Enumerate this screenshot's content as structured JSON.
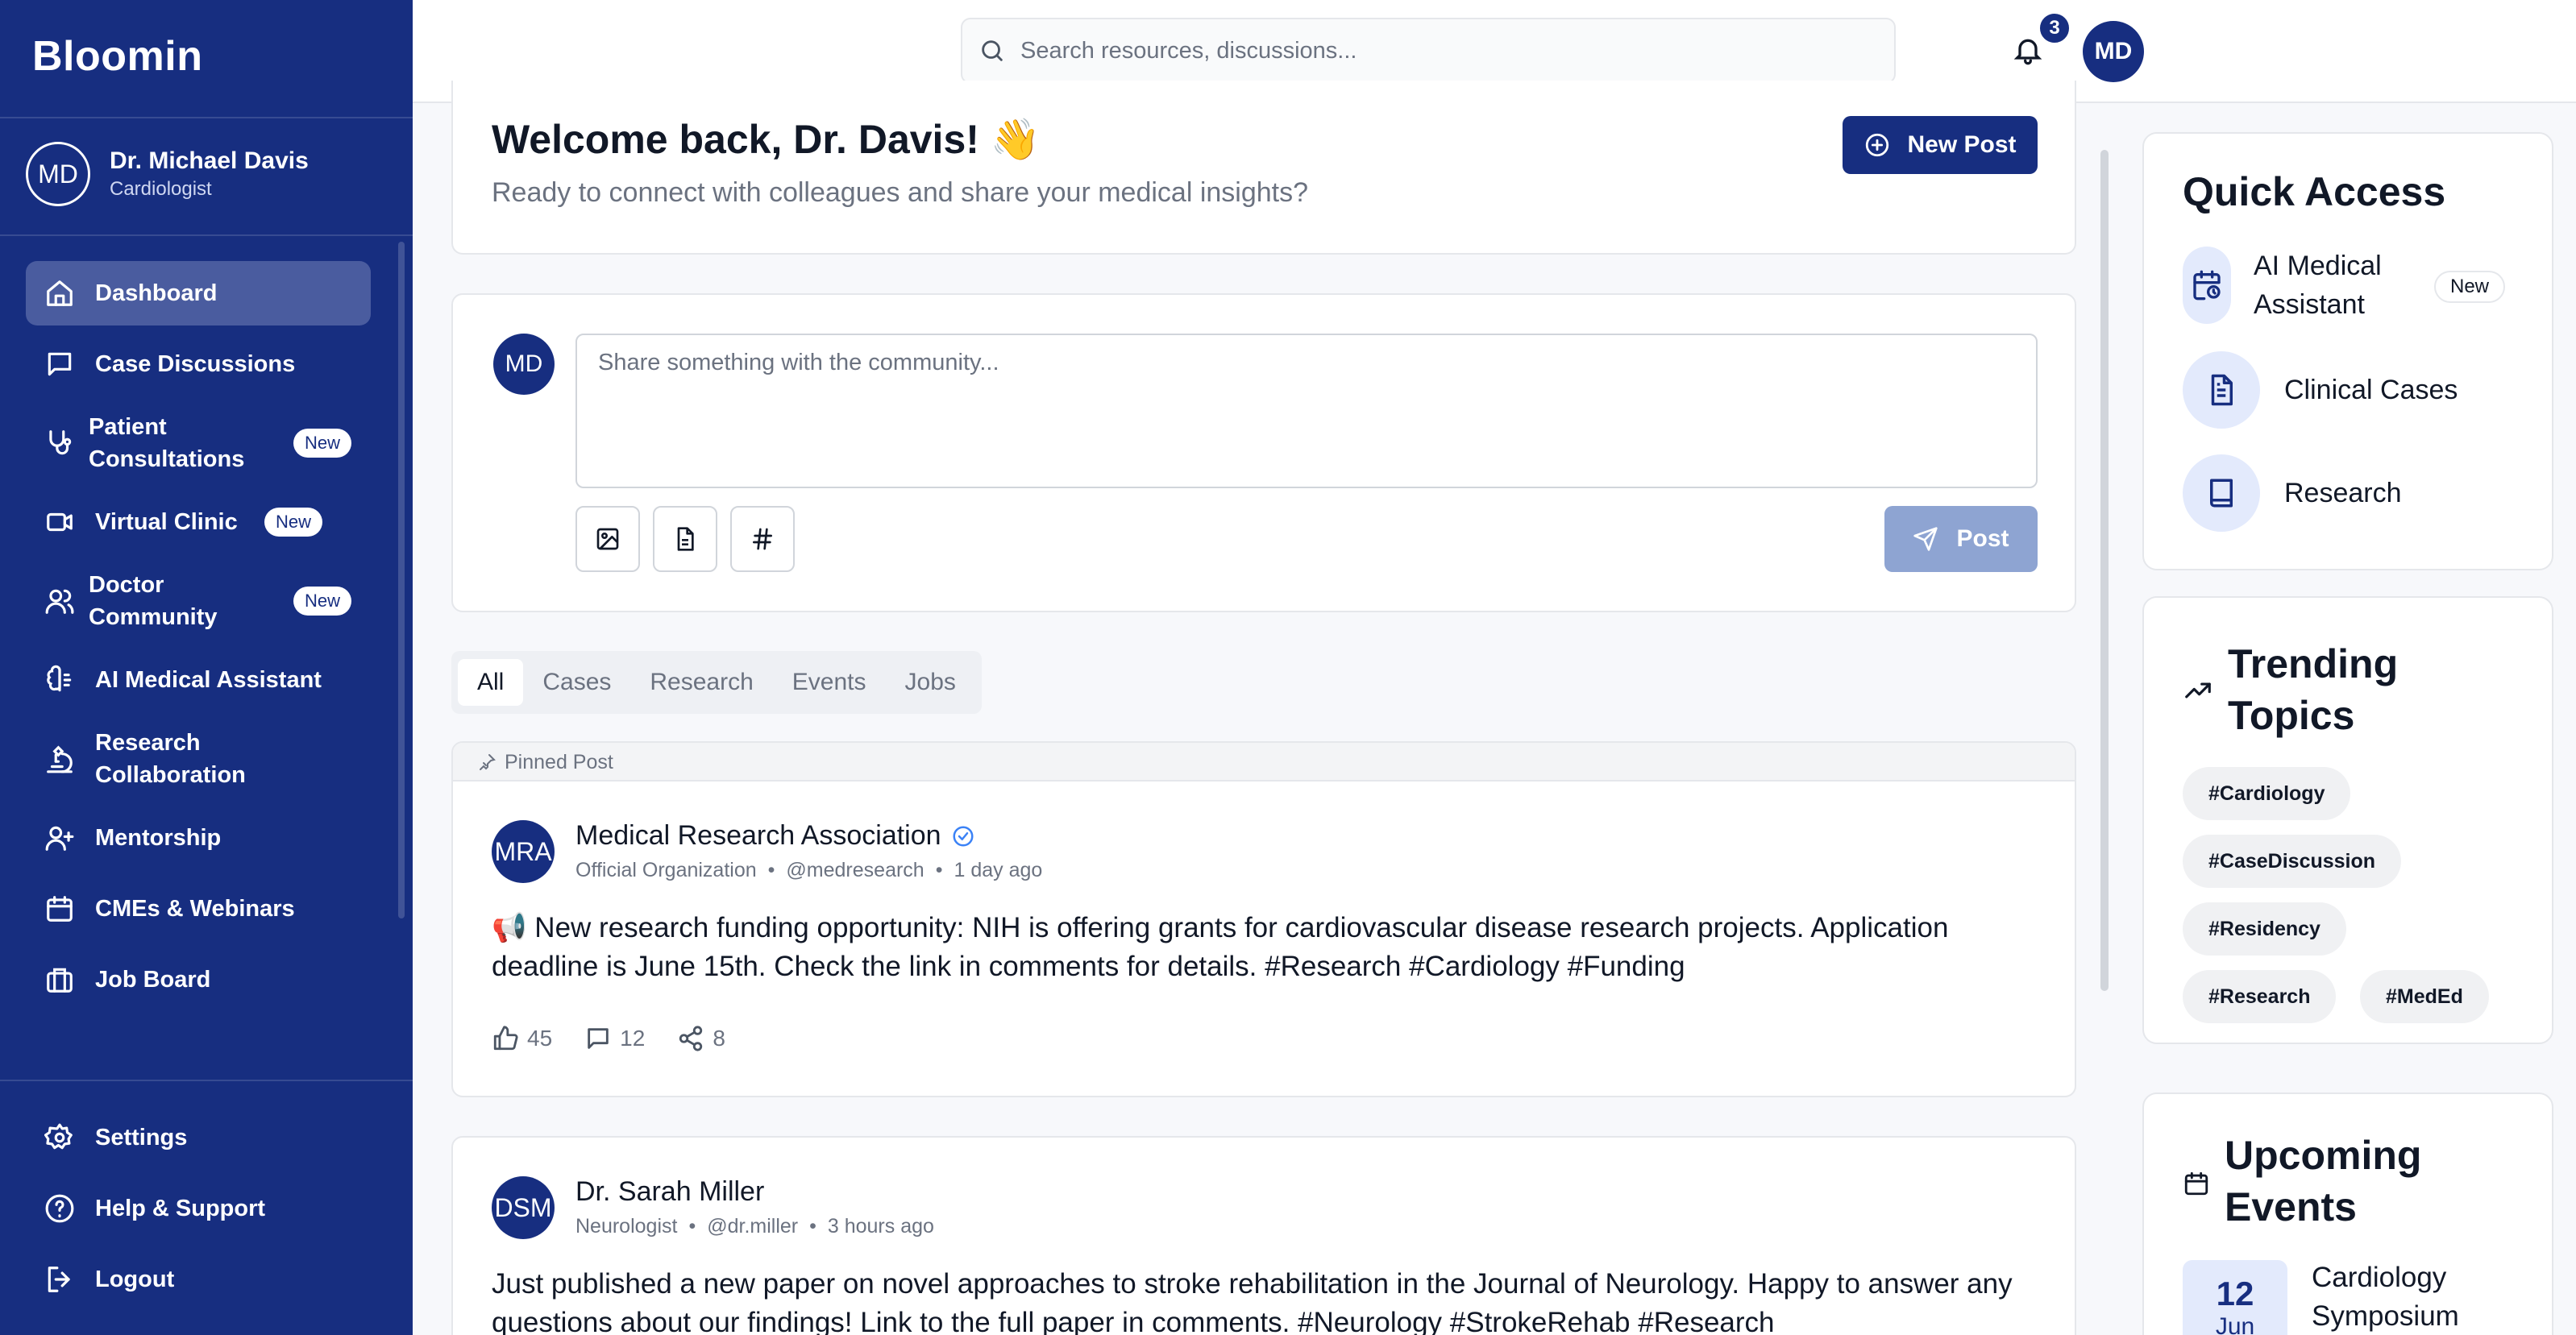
{
  "app": {
    "name": "Bloomin"
  },
  "user": {
    "name": "Dr. Michael Davis",
    "role": "Cardiologist",
    "initials": "MD"
  },
  "sidebar": {
    "items": [
      {
        "label": "Dashboard",
        "icon": "home-icon",
        "active": true
      },
      {
        "label": "Case Discussions",
        "icon": "message-square-icon"
      },
      {
        "label": "Patient Consultations",
        "icon": "stethoscope-icon",
        "badge": "New"
      },
      {
        "label": "Virtual Clinic",
        "icon": "video-icon",
        "badge": "New"
      },
      {
        "label": "Doctor Community",
        "icon": "users-icon",
        "badge": "New"
      },
      {
        "label": "AI Medical Assistant",
        "icon": "brain-icon"
      },
      {
        "label": "Research Collaboration",
        "icon": "microscope-icon"
      },
      {
        "label": "Mentorship",
        "icon": "user-plus-icon"
      },
      {
        "label": "CMEs & Webinars",
        "icon": "calendar-icon"
      },
      {
        "label": "Job Board",
        "icon": "briefcase-icon"
      }
    ],
    "bottom_items": [
      {
        "label": "Settings",
        "icon": "gear-icon"
      },
      {
        "label": "Help & Support",
        "icon": "help-circle-icon"
      },
      {
        "label": "Logout",
        "icon": "logout-icon"
      }
    ]
  },
  "topbar": {
    "search_placeholder": "Search resources, discussions...",
    "notification_count": "3",
    "avatar_initials": "MD"
  },
  "welcome": {
    "title": "Welcome back, Dr. Davis! 👋",
    "subtitle": "Ready to connect with colleagues and share your medical insights?",
    "new_post_label": "New Post"
  },
  "composer": {
    "avatar_initials": "MD",
    "placeholder": "Share something with the community...",
    "post_label": "Post"
  },
  "feed_tabs": [
    "All",
    "Cases",
    "Research",
    "Events",
    "Jobs"
  ],
  "posts": [
    {
      "pinned_label": "Pinned Post",
      "initials": "MRA",
      "author": "Medical Research Association",
      "verified": true,
      "role": "Official Organization",
      "handle": "@medresearch",
      "time": "1 day ago",
      "body": "📢 New research funding opportunity: NIH is offering grants for cardiovascular disease research projects. Application deadline is June 15th. Check the link in comments for details. #Research #Cardiology #Funding",
      "likes": "45",
      "comments": "12",
      "shares": "8"
    },
    {
      "initials": "DSM",
      "author": "Dr. Sarah Miller",
      "role": "Neurologist",
      "handle": "@dr.miller",
      "time": "3 hours ago",
      "body": "Just published a new paper on novel approaches to stroke rehabilitation in the Journal of Neurology. Happy to answer any questions about our findings! Link to the full paper in comments. #Neurology #StrokeRehab #Research"
    }
  ],
  "quick_access": {
    "title": "Quick Access",
    "items": [
      {
        "label": "AI Medical Assistant",
        "icon": "calendar-clock-icon",
        "badge": "New"
      },
      {
        "label": "Clinical Cases",
        "icon": "file-text-icon"
      },
      {
        "label": "Research",
        "icon": "book-icon"
      }
    ]
  },
  "trending": {
    "title": "Trending Topics",
    "tags": [
      "#Cardiology",
      "#CaseDiscussion",
      "#Residency",
      "#Research",
      "#MedEd"
    ]
  },
  "events": {
    "title": "Upcoming Events",
    "items": [
      {
        "day": "12",
        "month": "Jun",
        "title": "Cardiology Symposium"
      }
    ]
  }
}
